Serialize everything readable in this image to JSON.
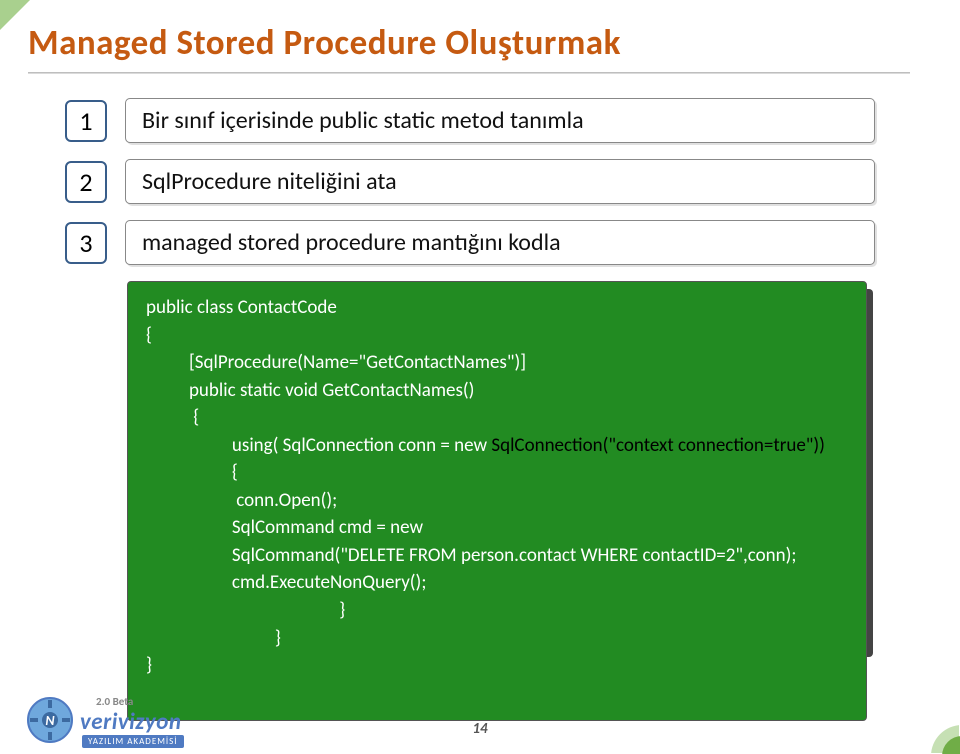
{
  "title": "Managed Stored Procedure Oluşturmak",
  "steps": [
    {
      "num": "1",
      "text": "Bir sınıf içerisinde public static metod tanımla"
    },
    {
      "num": "2",
      "text": "SqlProcedure niteliğini ata"
    },
    {
      "num": "3",
      "text": "managed stored procedure mantığını kodla"
    }
  ],
  "code": {
    "l1": "public class ContactCode",
    "l2": "{",
    "l3": "          [SqlProcedure(Name=\"GetContactNames\")]",
    "l4": "          public static void GetContactNames()",
    "l5": "           {",
    "l6a": "                    using( SqlConnection conn = new ",
    "l6b": "SqlConnection(\"context connection=true\"))",
    "l7": "                    {",
    "l8": "                     conn.Open();",
    "l9": "                    SqlCommand cmd = new",
    "l10": "                    SqlCommand(\"DELETE FROM person.contact WHERE contactID=2\",conn);",
    "l11": "                    cmd.ExecuteNonQuery();",
    "l12": "                                             }",
    "l13": "                              }",
    "l14": "}"
  },
  "footer": {
    "beta": "2.0 Beta",
    "brand": "verivizyon",
    "tagline": "YAZILIM AKADEMİSİ",
    "page": "14"
  }
}
